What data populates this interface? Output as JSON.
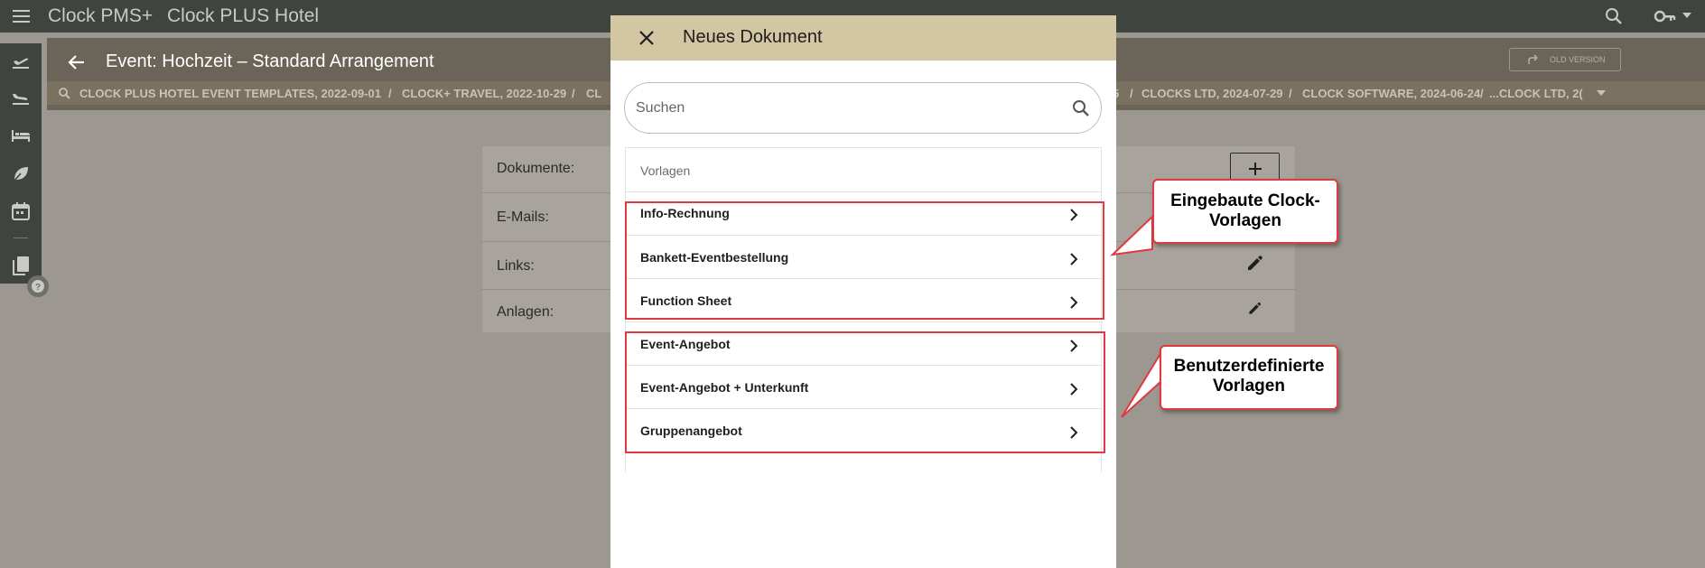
{
  "app": {
    "name": "Clock PMS+",
    "hotel": "Clock PLUS Hotel"
  },
  "header": {
    "event_title": "Event: Hochzeit – Standard Arrangement",
    "old_version_label": "OLD VERSION",
    "breadcrumbs": [
      "CLOCK PLUS HOTEL EVENT TEMPLATES, 2022-09-01",
      "CLOCK+ TRAVEL, 2022-10-29",
      "CL",
      "5",
      "CLOCKS LTD, 2024-07-29",
      "CLOCK SOFTWARE, 2024-06-24",
      "...CLOCK LTD, 2("
    ],
    "crumb_separator": "/"
  },
  "card": {
    "rows": [
      "Dokumente:",
      "E-Mails:",
      "Links:",
      "Anlagen:"
    ]
  },
  "dialog": {
    "title": "Neues Dokument",
    "search_placeholder": "Suchen",
    "list_header": "Vorlagen",
    "built_in_items": [
      "Info-Rechnung",
      "Bankett-Eventbestellung",
      "Function Sheet"
    ],
    "custom_items": [
      "Event-Angebot",
      "Event-Angebot + Unterkunft",
      "Gruppenangebot"
    ]
  },
  "callouts": {
    "built_in": [
      "Eingebaute Clock-",
      "Vorlagen"
    ],
    "custom": [
      "Benutzerdefinierte",
      "Vorlagen"
    ]
  },
  "colors": {
    "topbar": "#3f443f",
    "header": "#6b6458",
    "dialog_header": "#d3c6a2",
    "highlight": "#e0393f"
  }
}
